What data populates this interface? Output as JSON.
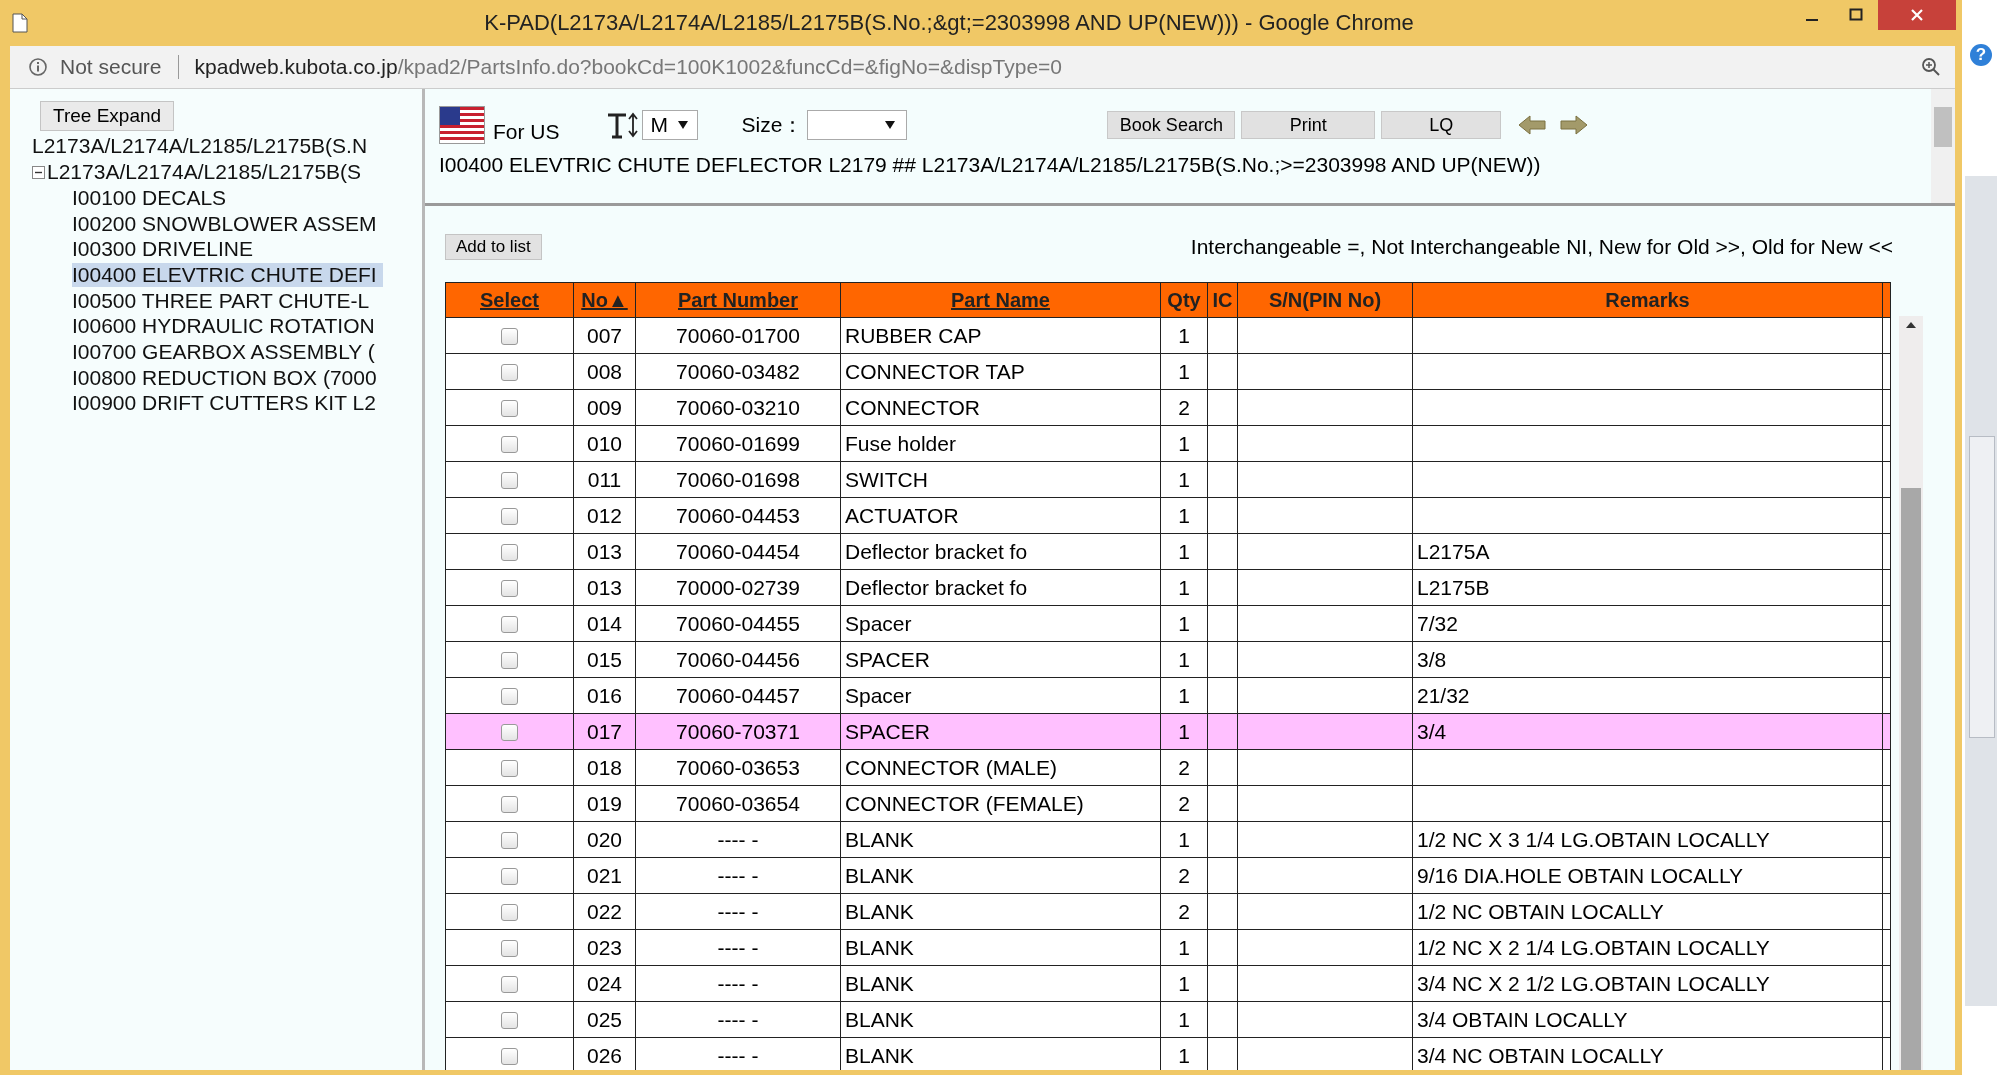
{
  "window": {
    "title": "K-PAD(L2173A/L2174A/L2185/L2175B(S.No.;&gt;=2303998 AND UP(NEW))) - Google Chrome"
  },
  "address_bar": {
    "security": "Not secure",
    "host": "kpadweb.kubota.co.jp",
    "path": "/kpad2/PartsInfo.do?bookCd=100K1002&funcCd=&figNo=&dispType=0"
  },
  "help": "?",
  "sidebar": {
    "button": "Tree Expand",
    "tree": [
      {
        "label": "L2173A/L2174A/L2185/L2175B(S.N"
      },
      {
        "label": "L2173A/L2174A/L2185/L2175B(S",
        "expanded": true,
        "children": [
          {
            "label": "I00100 DECALS",
            "selected": false
          },
          {
            "label": "I00200 SNOWBLOWER ASSEM",
            "selected": false
          },
          {
            "label": "I00300 DRIVELINE",
            "selected": false
          },
          {
            "label": "I00400 ELEVTRIC CHUTE DEFI",
            "selected": true
          },
          {
            "label": "I00500 THREE PART CHUTE-L",
            "selected": false
          },
          {
            "label": "I00600 HYDRAULIC ROTATION",
            "selected": false
          },
          {
            "label": "I00700 GEARBOX ASSEMBLY (",
            "selected": false
          },
          {
            "label": "I00800 REDUCTION BOX (7000",
            "selected": false
          },
          {
            "label": "I00900 DRIFT CUTTERS KIT L2",
            "selected": false
          }
        ]
      }
    ]
  },
  "toolbar": {
    "region": "For US",
    "font_size": "M",
    "size_label": "Size：",
    "buttons": [
      "Book Search",
      "Print",
      "LQ"
    ]
  },
  "heading": "I00400 ELEVTRIC CHUTE DEFLECTOR L2179 ## L2173A/L2174A/L2185/L2175B(S.No.;>=2303998 AND UP(NEW))",
  "add_button": "Add to list",
  "legend": "Interchangeable =, Not Interchangeable NI, New for Old >>, Old for New <<",
  "table": {
    "columns": [
      {
        "label": "Select",
        "sortable": true
      },
      {
        "label": "No▲",
        "sortable": true
      },
      {
        "label": "Part Number",
        "sortable": true
      },
      {
        "label": "Part Name",
        "sortable": true
      },
      {
        "label": "Qty",
        "sortable": false
      },
      {
        "label": "IC",
        "sortable": false
      },
      {
        "label": "S/N(PIN No)",
        "sortable": false
      },
      {
        "label": "Remarks",
        "sortable": false
      }
    ],
    "rows": [
      {
        "no": "007",
        "part_number": "70060-01700",
        "part_name": "RUBBER CAP",
        "qty": "1",
        "checked": false,
        "selected": false
      },
      {
        "no": "008",
        "part_number": "70060-03482",
        "part_name": "CONNECTOR TAP",
        "qty": "1",
        "checked": false,
        "selected": false
      },
      {
        "no": "009",
        "part_number": "70060-03210",
        "part_name": "CONNECTOR",
        "qty": "2",
        "checked": false,
        "selected": false
      },
      {
        "no": "010",
        "part_number": "70060-01699",
        "part_name": "Fuse holder",
        "qty": "1",
        "checked": false,
        "selected": false
      },
      {
        "no": "011",
        "part_number": "70060-01698",
        "part_name": "SWITCH",
        "qty": "1",
        "checked": false,
        "selected": false
      },
      {
        "no": "012",
        "part_number": "70060-04453",
        "part_name": "ACTUATOR",
        "qty": "1",
        "checked": false,
        "selected": false
      },
      {
        "no": "013",
        "part_number": "70060-04454",
        "part_name": "Deflector bracket fo",
        "qty": "1",
        "remarks": "L2175A",
        "checked": false,
        "selected": false
      },
      {
        "no": "013",
        "part_number": "70000-02739",
        "part_name": "Deflector bracket fo",
        "qty": "1",
        "remarks": "L2175B",
        "checked": false,
        "selected": false
      },
      {
        "no": "014",
        "part_number": "70060-04455",
        "part_name": "Spacer",
        "qty": "1",
        "remarks": "7/32",
        "checked": false,
        "selected": false
      },
      {
        "no": "015",
        "part_number": "70060-04456",
        "part_name": "SPACER",
        "qty": "1",
        "remarks": "3/8",
        "checked": false,
        "selected": false
      },
      {
        "no": "016",
        "part_number": "70060-04457",
        "part_name": "Spacer",
        "qty": "1",
        "remarks": "21/32",
        "checked": false,
        "selected": false
      },
      {
        "no": "017",
        "part_number": "70060-70371",
        "part_name": "SPACER",
        "qty": "1",
        "remarks": "3/4",
        "checked": false,
        "selected": true
      },
      {
        "no": "018",
        "part_number": "70060-03653",
        "part_name": "CONNECTOR (MALE)",
        "qty": "2",
        "checked": false,
        "selected": false
      },
      {
        "no": "019",
        "part_number": "70060-03654",
        "part_name": "CONNECTOR (FEMALE)",
        "qty": "2",
        "checked": false,
        "selected": false
      },
      {
        "no": "020",
        "part_number": "---- -",
        "part_name": "BLANK",
        "qty": "1",
        "remarks": "1/2 NC X 3 1/4 LG.OBTAIN LOCALLY",
        "checked": false,
        "selected": false
      },
      {
        "no": "021",
        "part_number": "---- -",
        "part_name": "BLANK",
        "qty": "2",
        "remarks": "9/16 DIA.HOLE OBTAIN LOCALLY",
        "checked": false,
        "selected": false
      },
      {
        "no": "022",
        "part_number": "---- -",
        "part_name": "BLANK",
        "qty": "2",
        "remarks": "1/2 NC OBTAIN LOCALLY",
        "checked": false,
        "selected": false
      },
      {
        "no": "023",
        "part_number": "---- -",
        "part_name": "BLANK",
        "qty": "1",
        "remarks": "1/2 NC X 2 1/4 LG.OBTAIN LOCALLY",
        "checked": false,
        "selected": false
      },
      {
        "no": "024",
        "part_number": "---- -",
        "part_name": "BLANK",
        "qty": "1",
        "remarks": "3/4 NC X 2 1/2 LG.OBTAIN LOCALLY",
        "checked": false,
        "selected": false
      },
      {
        "no": "025",
        "part_number": "---- -",
        "part_name": "BLANK",
        "qty": "1",
        "remarks": "3/4 OBTAIN LOCALLY",
        "checked": false,
        "selected": false
      },
      {
        "no": "026",
        "part_number": "---- -",
        "part_name": "BLANK",
        "qty": "1",
        "remarks": "3/4 NC OBTAIN LOCALLY",
        "checked": false,
        "selected": false
      }
    ]
  }
}
